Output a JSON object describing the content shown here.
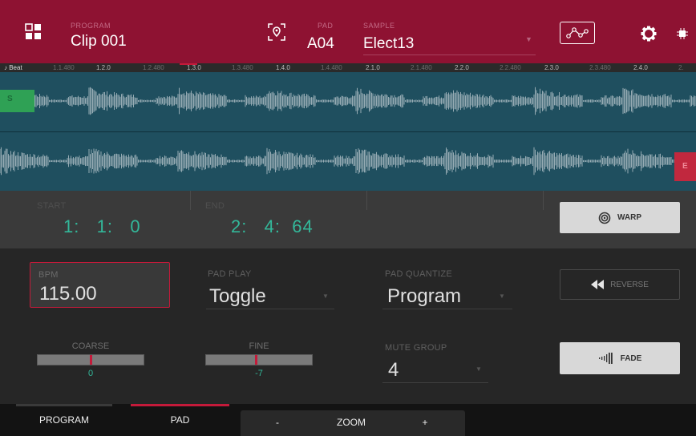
{
  "header": {
    "program_caption": "PROGRAM",
    "program_value": "Clip 001",
    "pad_caption": "PAD",
    "pad_value": "A04",
    "sample_caption": "SAMPLE",
    "sample_value": "Elect13"
  },
  "icons": {
    "grid": "grid-icon",
    "pad_locate": "pad-locate-icon",
    "envelope": "envelope-icon",
    "settings": "gear-icon",
    "chip": "chip-icon"
  },
  "ruler": {
    "beat_label": "♪ Beat",
    "ticks": [
      "1.1.480",
      "1.2.0",
      "1.2.480",
      "1.3.0",
      "1.3.480",
      "1.4.0",
      "1.4.480",
      "2.1.0",
      "2.1.480",
      "2.2.0",
      "2.2.480",
      "2.3.0",
      "2.3.480",
      "2.4.0",
      "2."
    ]
  },
  "markers": {
    "start": "S",
    "end": "E"
  },
  "startend": {
    "start_caption": "START",
    "start_value": "1:   1:   0",
    "end_caption": "END",
    "end_value": "2:   4:  64"
  },
  "buttons": {
    "warp": "WARP",
    "reverse": "REVERSE",
    "fade": "FADE"
  },
  "bpm": {
    "caption": "BPM",
    "value": "115.00"
  },
  "pad_play": {
    "caption": "PAD PLAY",
    "value": "Toggle"
  },
  "pad_quantize": {
    "caption": "PAD QUANTIZE",
    "value": "Program"
  },
  "coarse": {
    "caption": "COARSE",
    "value": "0",
    "level": 0.5
  },
  "fine": {
    "caption": "FINE",
    "value": "-7",
    "level": 0.47
  },
  "mute_group": {
    "caption": "MUTE GROUP",
    "value": "4"
  },
  "bottom": {
    "program": "PROGRAM",
    "pad": "PAD",
    "minus": "-",
    "zoom": "ZOOM",
    "plus": "+"
  },
  "colors": {
    "header": "#8e1232",
    "accent": "#c41a3a",
    "value_green": "#33b89a",
    "wave_bg": "#1f4f5f"
  }
}
